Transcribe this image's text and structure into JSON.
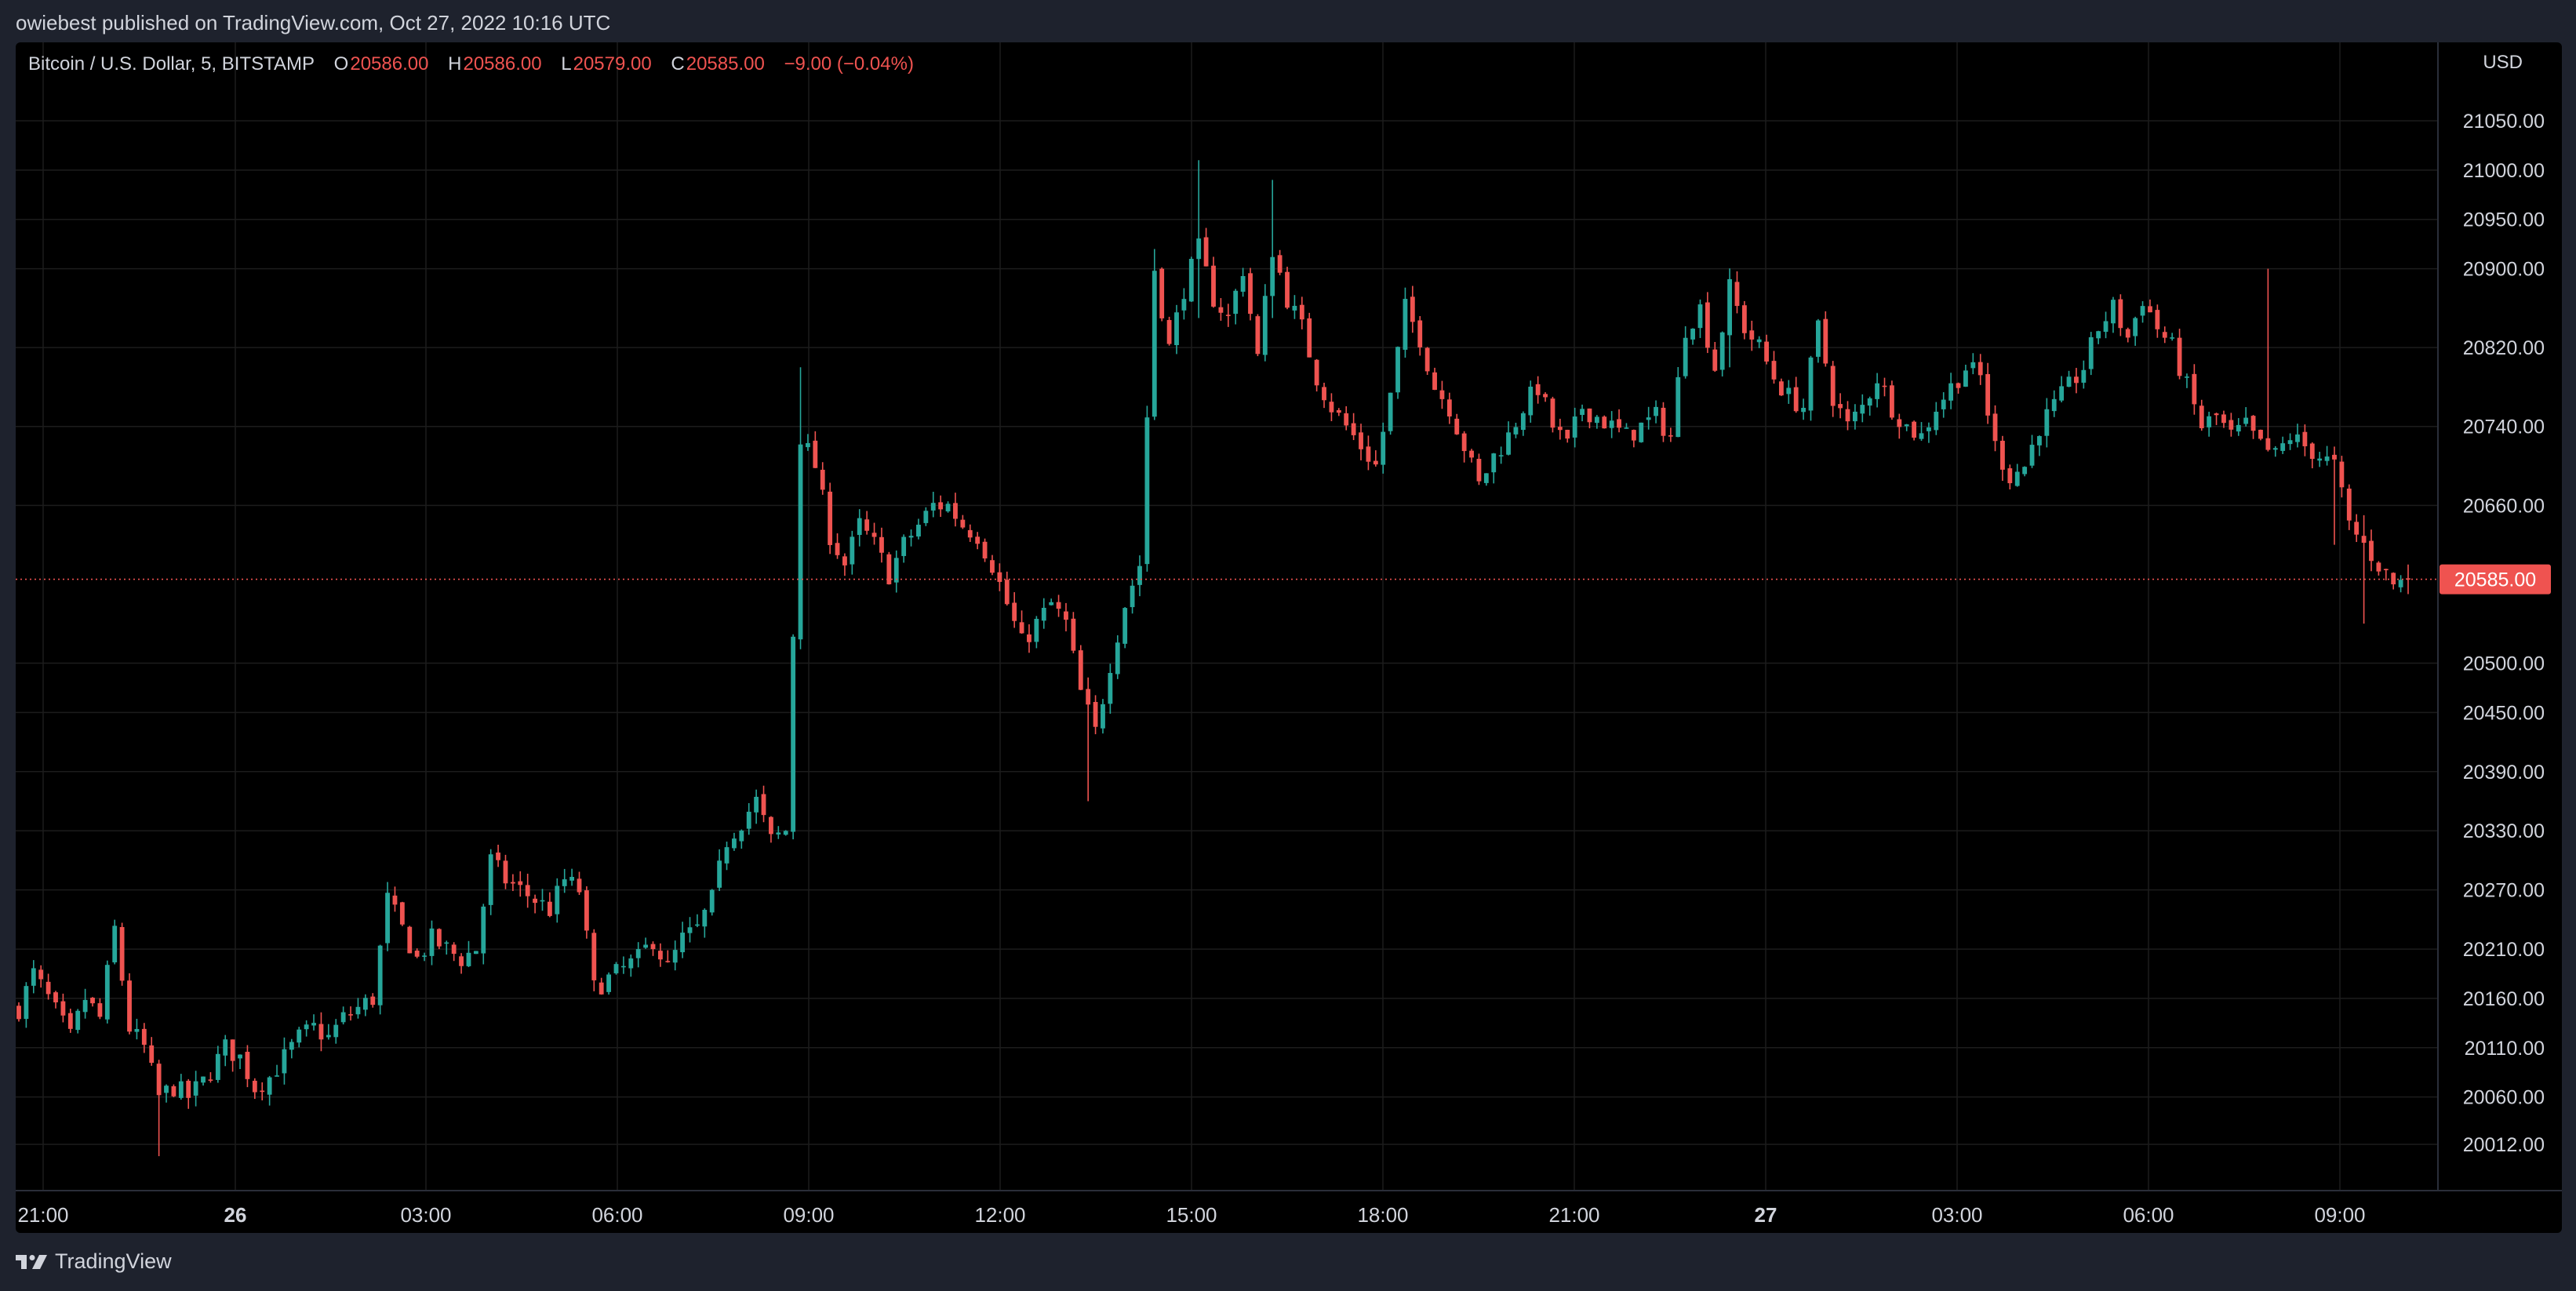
{
  "caption": "owiebest published on TradingView.com, Oct 27, 2022 10:16 UTC",
  "legend": {
    "symbol": "Bitcoin / U.S. Dollar, 5, BITSTAMP",
    "open_key": "O",
    "open": "20586.00",
    "high_key": "H",
    "high": "20586.00",
    "low_key": "L",
    "low": "20579.00",
    "close_key": "C",
    "close": "20585.00",
    "change": "−9.00 (−0.04%)"
  },
  "currency": "USD",
  "brand": "TradingView",
  "colors": {
    "up": "#26a69a",
    "down": "#ef5350",
    "background": "#000000",
    "grid": "#1c1c1c",
    "axis_text": "#d1d4dc",
    "last_price_label": "#ef5350"
  },
  "chart_data": {
    "type": "candlestick",
    "symbol": "Bitcoin / U.S. Dollar",
    "interval": "5",
    "exchange": "BITSTAMP",
    "y_ticks": [
      21050,
      21000,
      20950,
      20900,
      20820,
      20740,
      20660,
      20500,
      20450,
      20390,
      20330,
      20270,
      20210,
      20160,
      20110,
      20060,
      20012
    ],
    "y_tick_labels": [
      "21050.00",
      "21000.00",
      "20950.00",
      "20900.00",
      "20820.00",
      "20740.00",
      "20660.00",
      "20500.00",
      "20450.00",
      "20390.00",
      "20330.00",
      "20270.00",
      "20210.00",
      "20160.00",
      "20110.00",
      "20060.00",
      "20012.00"
    ],
    "x_ticks": [
      {
        "label": "21:00",
        "bold": false
      },
      {
        "label": "26",
        "bold": true
      },
      {
        "label": "03:00",
        "bold": false
      },
      {
        "label": "06:00",
        "bold": false
      },
      {
        "label": "09:00",
        "bold": false
      },
      {
        "label": "12:00",
        "bold": false
      },
      {
        "label": "15:00",
        "bold": false
      },
      {
        "label": "18:00",
        "bold": false
      },
      {
        "label": "21:00",
        "bold": false
      },
      {
        "label": "27",
        "bold": true
      },
      {
        "label": "03:00",
        "bold": false
      },
      {
        "label": "06:00",
        "bold": false
      },
      {
        "label": "09:00",
        "bold": false
      }
    ],
    "last_price": 20585,
    "last_price_label": "20585.00",
    "series_anchors": [
      [
        0,
        20150
      ],
      [
        2,
        20185
      ],
      [
        4,
        20160
      ],
      [
        7,
        20120
      ],
      [
        9,
        20160
      ],
      [
        11,
        20140
      ],
      [
        13,
        20230
      ],
      [
        15,
        20130
      ],
      [
        17,
        20110
      ],
      [
        19,
        20060
      ],
      [
        21,
        20070
      ],
      [
        23,
        20060
      ],
      [
        25,
        20075
      ],
      [
        28,
        20110
      ],
      [
        30,
        20100
      ],
      [
        32,
        20070
      ],
      [
        34,
        20080
      ],
      [
        36,
        20100
      ],
      [
        38,
        20120
      ],
      [
        40,
        20130
      ],
      [
        42,
        20120
      ],
      [
        44,
        20140
      ],
      [
        46,
        20150
      ],
      [
        48,
        20160
      ],
      [
        50,
        20260
      ],
      [
        52,
        20230
      ],
      [
        54,
        20200
      ],
      [
        56,
        20220
      ],
      [
        58,
        20210
      ],
      [
        60,
        20200
      ],
      [
        62,
        20210
      ],
      [
        64,
        20300
      ],
      [
        66,
        20280
      ],
      [
        68,
        20270
      ],
      [
        70,
        20260
      ],
      [
        72,
        20250
      ],
      [
        74,
        20280
      ],
      [
        76,
        20270
      ],
      [
        78,
        20170
      ],
      [
        80,
        20180
      ],
      [
        82,
        20190
      ],
      [
        84,
        20200
      ],
      [
        86,
        20220
      ],
      [
        88,
        20190
      ],
      [
        90,
        20220
      ],
      [
        92,
        20230
      ],
      [
        94,
        20260
      ],
      [
        96,
        20320
      ],
      [
        98,
        20340
      ],
      [
        100,
        20360
      ],
      [
        102,
        20320
      ],
      [
        104,
        20330
      ],
      [
        106,
        20730
      ],
      [
        108,
        20700
      ],
      [
        110,
        20630
      ],
      [
        112,
        20600
      ],
      [
        114,
        20640
      ],
      [
        116,
        20620
      ],
      [
        118,
        20590
      ],
      [
        120,
        20620
      ],
      [
        122,
        20640
      ],
      [
        124,
        20660
      ],
      [
        126,
        20660
      ],
      [
        128,
        20640
      ],
      [
        130,
        20630
      ],
      [
        132,
        20600
      ],
      [
        134,
        20560
      ],
      [
        136,
        20520
      ],
      [
        138,
        20540
      ],
      [
        140,
        20560
      ],
      [
        142,
        20540
      ],
      [
        144,
        20470
      ],
      [
        146,
        20430
      ],
      [
        148,
        20500
      ],
      [
        150,
        20560
      ],
      [
        152,
        20600
      ],
      [
        154,
        20900
      ],
      [
        156,
        20820
      ],
      [
        158,
        20880
      ],
      [
        160,
        20920
      ],
      [
        162,
        20870
      ],
      [
        164,
        20850
      ],
      [
        166,
        20900
      ],
      [
        168,
        20810
      ],
      [
        170,
        20920
      ],
      [
        172,
        20870
      ],
      [
        174,
        20840
      ],
      [
        176,
        20790
      ],
      [
        178,
        20760
      ],
      [
        180,
        20740
      ],
      [
        182,
        20720
      ],
      [
        184,
        20700
      ],
      [
        186,
        20770
      ],
      [
        188,
        20860
      ],
      [
        190,
        20830
      ],
      [
        192,
        20780
      ],
      [
        194,
        20760
      ],
      [
        196,
        20720
      ],
      [
        198,
        20680
      ],
      [
        200,
        20710
      ],
      [
        202,
        20730
      ],
      [
        204,
        20760
      ],
      [
        206,
        20780
      ],
      [
        208,
        20740
      ],
      [
        210,
        20720
      ],
      [
        212,
        20760
      ],
      [
        214,
        20750
      ],
      [
        216,
        20740
      ],
      [
        218,
        20730
      ],
      [
        220,
        20740
      ],
      [
        222,
        20750
      ],
      [
        224,
        20730
      ],
      [
        226,
        20840
      ],
      [
        228,
        20860
      ],
      [
        230,
        20800
      ],
      [
        232,
        20880
      ],
      [
        234,
        20840
      ],
      [
        236,
        20820
      ],
      [
        238,
        20790
      ],
      [
        240,
        20770
      ],
      [
        242,
        20760
      ],
      [
        244,
        20840
      ],
      [
        246,
        20770
      ],
      [
        248,
        20740
      ],
      [
        250,
        20760
      ],
      [
        252,
        20790
      ],
      [
        254,
        20760
      ],
      [
        256,
        20740
      ],
      [
        258,
        20730
      ],
      [
        260,
        20760
      ],
      [
        262,
        20780
      ],
      [
        264,
        20800
      ],
      [
        266,
        20790
      ],
      [
        268,
        20720
      ],
      [
        270,
        20690
      ],
      [
        272,
        20700
      ],
      [
        274,
        20740
      ],
      [
        276,
        20760
      ],
      [
        278,
        20780
      ],
      [
        280,
        20800
      ],
      [
        282,
        20840
      ],
      [
        284,
        20860
      ],
      [
        286,
        20830
      ],
      [
        288,
        20870
      ],
      [
        290,
        20840
      ],
      [
        292,
        20820
      ],
      [
        294,
        20780
      ],
      [
        296,
        20740
      ],
      [
        298,
        20750
      ],
      [
        300,
        20730
      ],
      [
        302,
        20740
      ],
      [
        304,
        20720
      ],
      [
        306,
        20710
      ],
      [
        308,
        20730
      ],
      [
        310,
        20720
      ],
      [
        312,
        20710
      ],
      [
        314,
        20700
      ],
      [
        316,
        20640
      ],
      [
        318,
        20620
      ],
      [
        320,
        20600
      ],
      [
        322,
        20580
      ],
      [
        324,
        20585
      ]
    ]
  }
}
